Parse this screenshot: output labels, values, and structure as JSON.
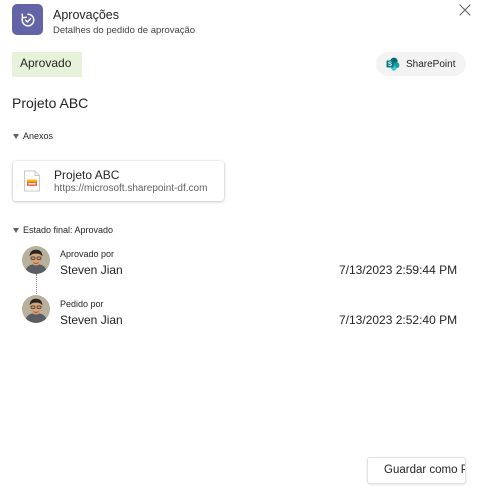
{
  "header": {
    "title": "Aprovações",
    "subtitle": "Detalhes do pedido de aprovação",
    "app_icon": "approvals-refresh-icon",
    "close_icon": "close-icon",
    "accent_color": "#6264a7"
  },
  "status": {
    "label": "Aprovado",
    "color": "#e7f2da"
  },
  "source": {
    "label": "SharePoint",
    "icon": "sharepoint-icon"
  },
  "project": {
    "title": "Projeto ABC"
  },
  "attachments": {
    "header": "Anexos",
    "items": [
      {
        "name": "Projeto ABC",
        "url": "https://microsoft.sharepoint-df.com",
        "icon": "presentation-file-icon"
      }
    ]
  },
  "final_state": {
    "header": "Estado final: Aprovado",
    "steps": [
      {
        "label": "Aprovado por",
        "name": "Steven Jian",
        "time": "7/13/2023 2:59:44 PM"
      },
      {
        "label": "Pedido por",
        "name": "Steven Jian",
        "time": "7/13/2023 2:52:40 PM"
      }
    ]
  },
  "footer": {
    "pdf_button": "Guardar como PDF"
  }
}
